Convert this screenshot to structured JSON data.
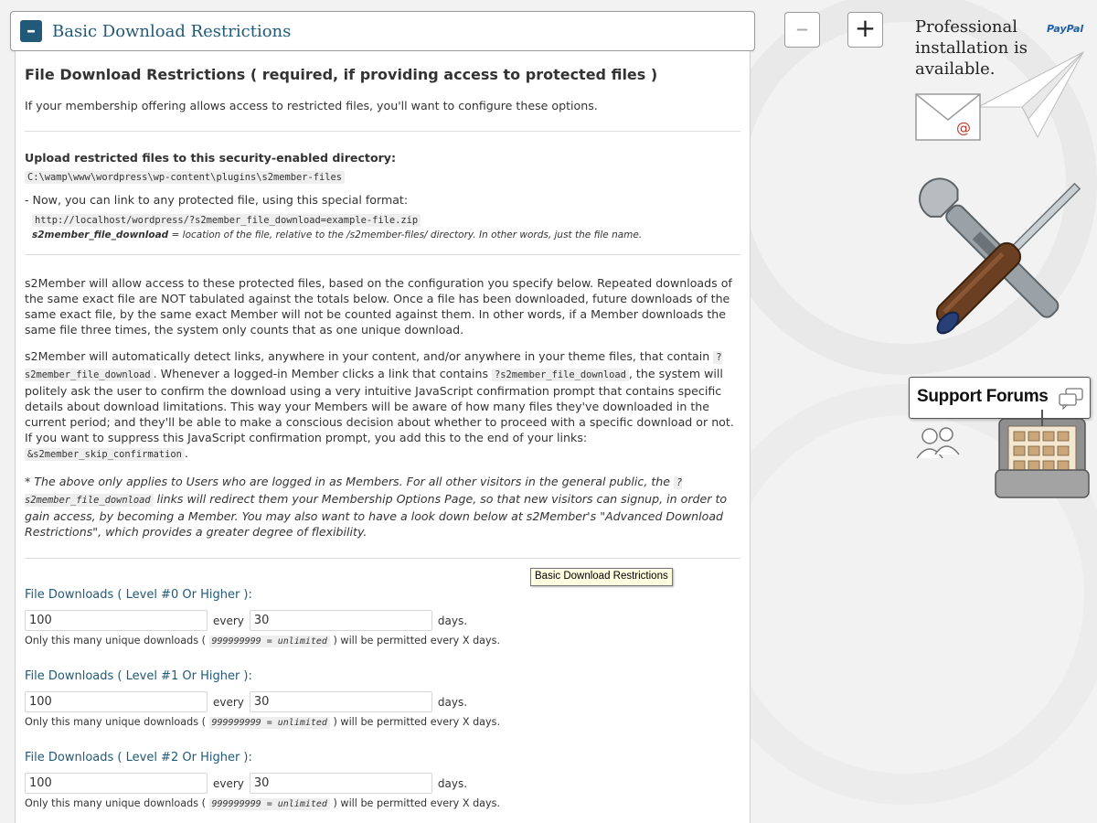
{
  "section": {
    "title": "Basic Download Restrictions",
    "toggle_symbol": "–"
  },
  "controls": {
    "collapse_symbol": "–",
    "expand_symbol": "+"
  },
  "intro": {
    "heading": "File Download Restrictions ( required, if providing access to protected files )",
    "description": "If your membership offering allows access to restricted files, you'll want to configure these options."
  },
  "upload": {
    "label": "Upload restricted files to this security-enabled directory:",
    "path": "C:\\wamp\\www\\wordpress\\wp-content\\plugins\\s2member-files",
    "link_intro": "- Now, you can link to any protected file, using this special format:",
    "link_example": "http://localhost/wordpress/?s2member_file_download=example-file.zip",
    "param_name": "s2member_file_download",
    "param_desc": " = location of the file, relative to the /s2member-files/ directory. In other words, just the file name."
  },
  "explain": {
    "p1": "s2Member will allow access to these protected files, based on the configuration you specify below. Repeated downloads of the same exact file are NOT tabulated against the totals below. Once a file has been downloaded, future downloads of the same exact file, by the same exact Member will not be counted against them. In other words, if a Member downloads the same file three times, the system only counts that as one unique download.",
    "p2a": "s2Member will automatically detect links, anywhere in your content, and/or anywhere in your theme files, that contain ",
    "p2_code1": "?s2member_file_download",
    "p2b": ". Whenever a logged-in Member clicks a link that contains ",
    "p2_code2": "?s2member_file_download",
    "p2c": ", the system will politely ask the user to confirm the download using a very intuitive JavaScript confirmation prompt that contains specific details about download limitations. This way your Members will be aware of how many files they've downloaded in the current period; and they'll be able to make a conscious decision about whether to proceed with a specific download or not. If you want to suppress this JavaScript confirmation prompt, you add this to the end of your links: ",
    "p2_code3": "&s2member_skip_confirmation",
    "p2d": ".",
    "p3a": "* The above only applies to Users who are logged in as Members. For all other visitors in the general public, the ",
    "p3_code": "?s2member_file_download",
    "p3b": " links will redirect them your Membership Options Page, so that new visitors can signup, in order to gain access, by becoming a Member. You may also want to have a look down below at s2Member's \"Advanced Download Restrictions\", which provides a greater degree of flexibility."
  },
  "tooltip": "Basic Download Restrictions",
  "levels": [
    {
      "label": "File Downloads ( Level #0 Or Higher ):",
      "downloads": "100",
      "every_label": "every",
      "days": "30",
      "days_label": "days.",
      "help_a": "Only this many unique downloads ( ",
      "help_code": "999999999 = unlimited",
      "help_b": " ) will be permitted every X days."
    },
    {
      "label": "File Downloads ( Level #1 Or Higher ):",
      "downloads": "100",
      "every_label": "every",
      "days": "30",
      "days_label": "days.",
      "help_a": "Only this many unique downloads ( ",
      "help_code": "999999999 = unlimited",
      "help_b": " ) will be permitted every X days."
    },
    {
      "label": "File Downloads ( Level #2 Or Higher ):",
      "downloads": "100",
      "every_label": "every",
      "days": "30",
      "days_label": "days.",
      "help_a": "Only this many unique downloads ( ",
      "help_code": "999999999 = unlimited",
      "help_b": " ) will be permitted every X days."
    }
  ],
  "sidebar": {
    "pro_install_line1": "Professional",
    "pro_install_line2": "installation is",
    "pro_install_line3": "available.",
    "paypal": "PayPal",
    "support_forums": "Support Forums"
  },
  "colors": {
    "accent": "#215a78",
    "tooltip_bg": "#ffffe1"
  }
}
